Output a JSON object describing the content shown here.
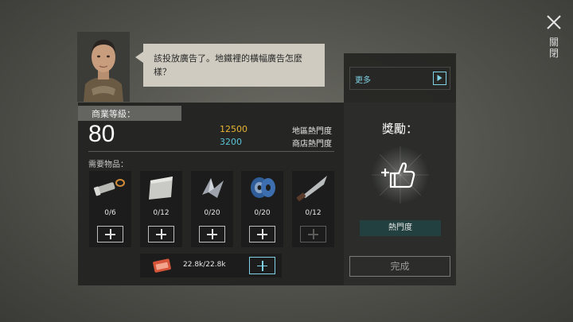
{
  "header": {
    "close_label": "關閉",
    "speech_text": "該投放廣告了。地鐵裡的橫幅廣告怎麼樣？",
    "more_label": "更多"
  },
  "business": {
    "level_label": "商業等級：",
    "level_value": "80",
    "region_heat_value": "12500",
    "region_heat_label": "地區熱門度",
    "shop_heat_value": "3200",
    "shop_heat_label": "商店熱門度",
    "colors": {
      "region_heat": "#e8b431",
      "shop_heat": "#58c3d6",
      "accent": "#7fd1e3"
    }
  },
  "required": {
    "label": "需要物品：",
    "items": [
      {
        "icon": "flashlight-icon",
        "count": "0/6",
        "add_enabled": true
      },
      {
        "icon": "metal-plate-icon",
        "count": "0/12",
        "add_enabled": true
      },
      {
        "icon": "scrap-metal-icon",
        "count": "0/20",
        "add_enabled": true
      },
      {
        "icon": "wire-spool-icon",
        "count": "0/20",
        "add_enabled": true
      },
      {
        "icon": "knife-icon",
        "count": "0/12",
        "add_enabled": false
      }
    ],
    "ticket": {
      "icon": "ticket-icon",
      "amount": "22.8k/22.8k"
    }
  },
  "reward": {
    "title": "獎勵：",
    "icon": "popularity-thumbs-up-icon",
    "badge_label": "熱門度",
    "complete_label": "完成"
  }
}
